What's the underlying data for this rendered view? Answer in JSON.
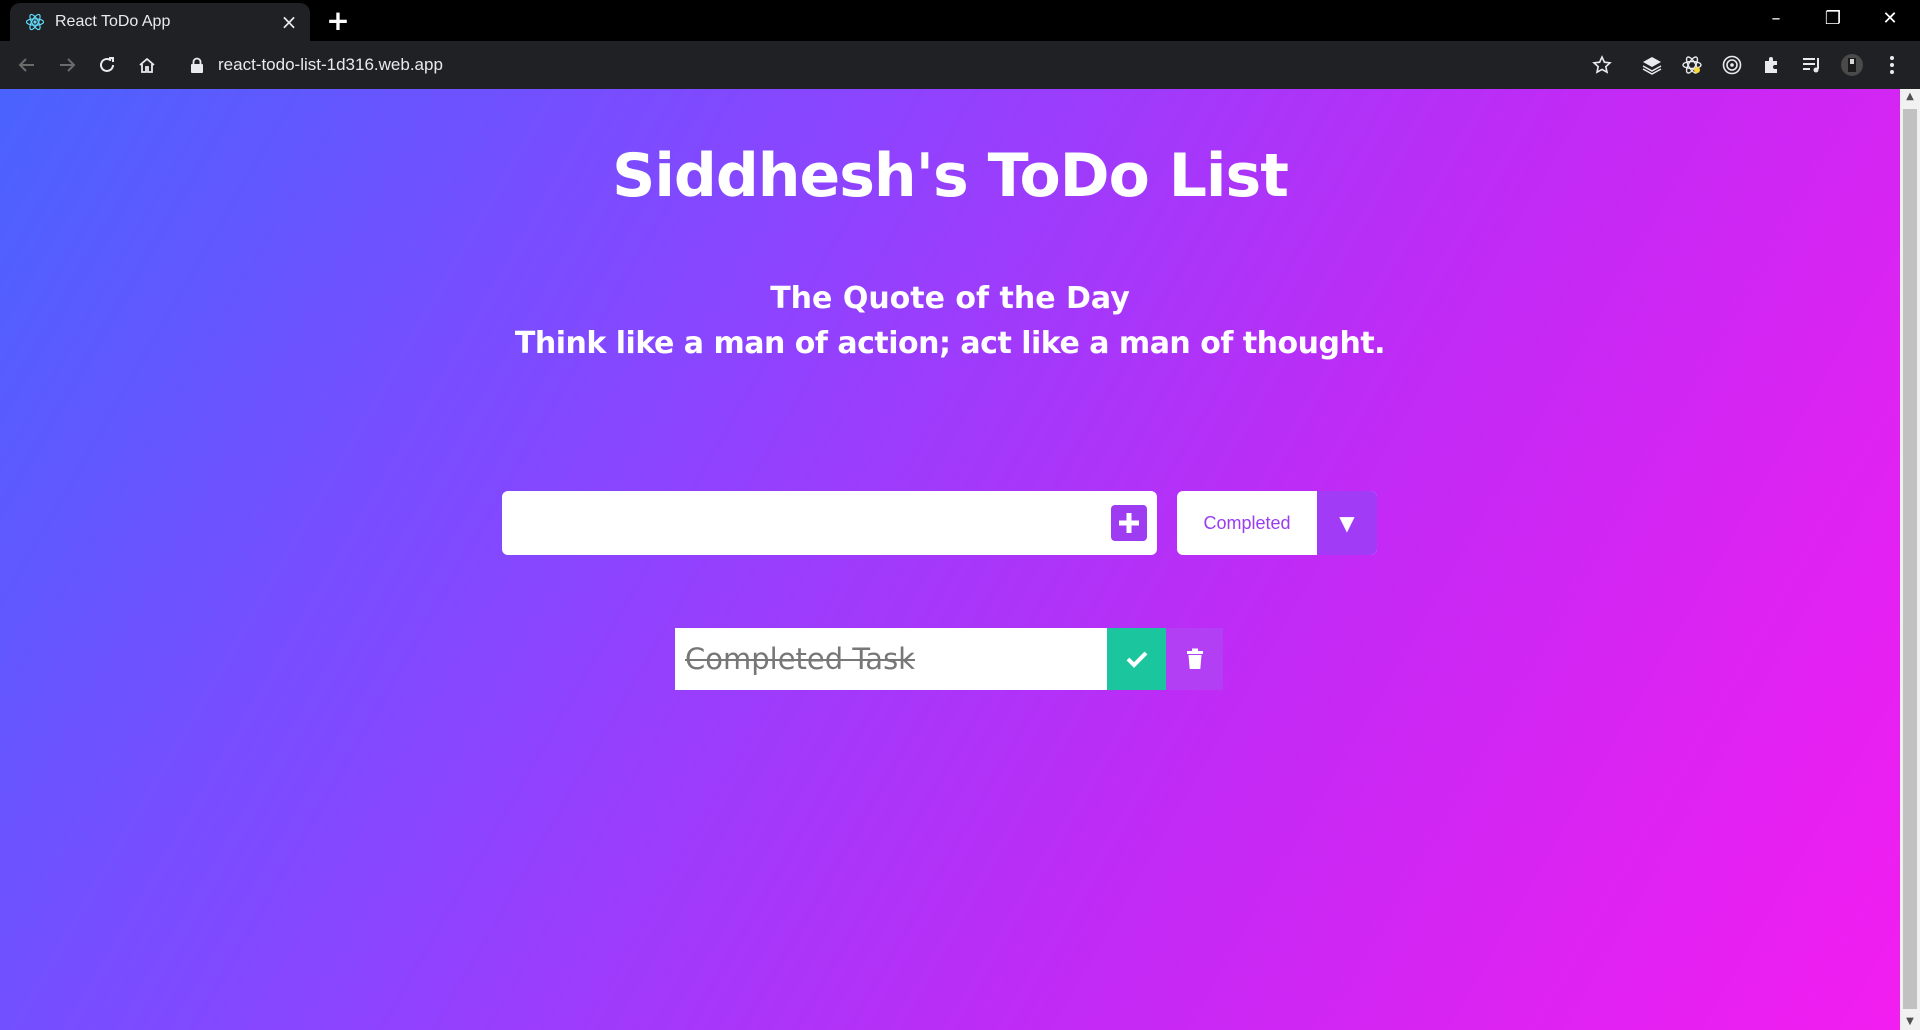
{
  "browser": {
    "tab_title": "React ToDo App",
    "url": "react-todo-list-1d316.web.app"
  },
  "page": {
    "heading": "Siddhesh's ToDo List",
    "quote_title": "The Quote of the Day",
    "quote_text": "Think like a man of action; act like a man of thought."
  },
  "form": {
    "input_value": "",
    "filter_selected": "Completed"
  },
  "todos": [
    {
      "text": "Completed Task",
      "completed": true
    }
  ],
  "colors": {
    "gradient_start": "#4a63ff",
    "gradient_end": "#f31df0",
    "accent_purple": "#9e3cf2",
    "complete_green": "#1bc59e"
  }
}
